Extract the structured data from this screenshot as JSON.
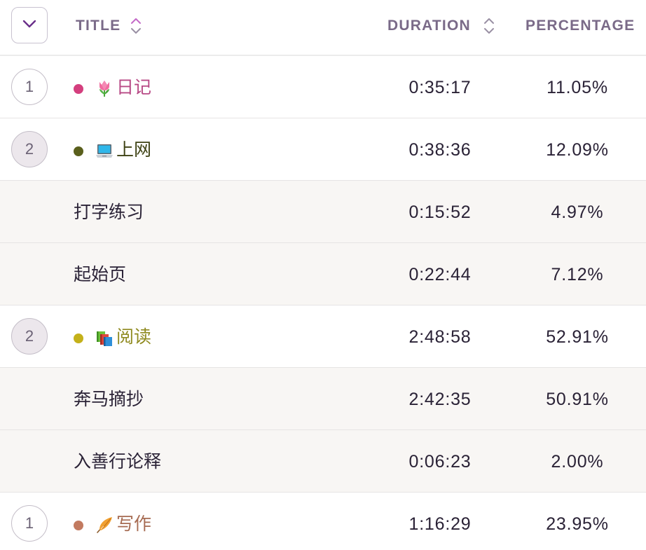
{
  "header": {
    "expand_icon": "chevron-down-icon",
    "columns": {
      "title": "TITLE",
      "duration": "DURATION",
      "percentage": "PERCENTAGE"
    },
    "colors": {
      "header_text": "#7a6a88",
      "title_sort_icon": "#c46ac8",
      "duration_sort_icon": "#9a90a4",
      "chevron": "#6a2f8a"
    }
  },
  "rows": [
    {
      "type": "group",
      "count": "1",
      "count_style": "outline",
      "dot_color": "#d43f7e",
      "emoji": "tulip",
      "title": "日记",
      "title_color": "#b84a86",
      "duration": "0:35:17",
      "percentage": "11.05%"
    },
    {
      "type": "group",
      "count": "2",
      "count_style": "filled",
      "dot_color": "#5a5f1c",
      "emoji": "laptop",
      "title": "上网",
      "title_color": "#3e4214",
      "duration": "0:38:36",
      "percentage": "12.09%"
    },
    {
      "type": "sub",
      "title": "打字练习",
      "duration": "0:15:52",
      "percentage": "4.97%"
    },
    {
      "type": "sub",
      "title": "起始页",
      "duration": "0:22:44",
      "percentage": "7.12%"
    },
    {
      "type": "group",
      "count": "2",
      "count_style": "filled",
      "dot_color": "#c4b11a",
      "emoji": "books",
      "title": "阅读",
      "title_color": "#8f8a1f",
      "duration": "2:48:58",
      "percentage": "52.91%"
    },
    {
      "type": "sub",
      "title": "奔马摘抄",
      "duration": "2:42:35",
      "percentage": "50.91%"
    },
    {
      "type": "sub",
      "title": "入善行论释",
      "duration": "0:06:23",
      "percentage": "2.00%"
    },
    {
      "type": "group",
      "count": "1",
      "count_style": "outline",
      "dot_color": "#c27a60",
      "emoji": "feather",
      "title": "写作",
      "title_color": "#a66b52",
      "duration": "1:16:29",
      "percentage": "23.95%"
    }
  ]
}
